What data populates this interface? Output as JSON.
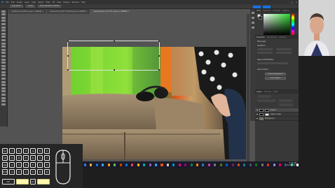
{
  "app": {
    "menu": [
      "Ps",
      "File",
      "Edit",
      "Image",
      "Layer",
      "Type",
      "Select",
      "Filter",
      "3D",
      "View",
      "Plugins",
      "Window",
      "Help"
    ],
    "window_controls": [
      "–",
      "□",
      "✕"
    ]
  },
  "options_bar": {
    "items": [
      "Auto-Select:",
      "Group",
      "Show Transform Controls"
    ]
  },
  "document_tabs": [
    {
      "label": "Untitled-1 @ 100% (Layer 0, RGB/8) ×",
      "active": false
    },
    {
      "label": "Screenshot @ 66.7% (Background, RGB/8) ×",
      "active": false
    },
    {
      "label": "pexels-photo @ 33.3% (Layer 1, RGB/8*) ×",
      "active": true
    }
  ],
  "panels": {
    "color": {
      "tabs": [
        "Color",
        "Swatches",
        "Gradients",
        "Patterns"
      ],
      "foreground": "#e8e8e8",
      "background": "#1b1b1b",
      "picker_hue": "#27d82a"
    },
    "properties": {
      "tabs": [
        "Properties",
        "Adjustments",
        "Libraries"
      ],
      "labels": [
        "Pixel Layer",
        "Transform",
        "Align and Distribute",
        "Quick Actions",
        "Remove Background",
        "Select Subject"
      ]
    },
    "layers": {
      "tabs": [
        "Layers",
        "Channels",
        "Paths"
      ],
      "rows": [
        {
          "label": "Layer 1",
          "selected": true
        },
        {
          "label": "Layer 0 copy",
          "selected": false
        },
        {
          "label": "Background",
          "selected": false
        }
      ]
    }
  },
  "taskbar": {
    "icons": [
      "#3a7bd5",
      "#e8b83a",
      "#1473e6",
      "#31a8ff",
      "#ff9a00",
      "#6cc24a",
      "#d83b01",
      "#0078d4",
      "#e74856",
      "#ffb900",
      "#00b294",
      "#8764b8",
      "#31a8ff",
      "#ff4f00",
      "#cccccc",
      "#0099bc",
      "#e3008c",
      "#9a0089",
      "#10893e",
      "#ff8c00",
      "#2d7d9a",
      "#c239b3",
      "#7a7574",
      "#498205",
      "#0063b1",
      "#68217a",
      "#ca5010",
      "#038387",
      "#4a5459",
      "#107c10",
      "#767676",
      "#da3b01",
      "#8e8cd8",
      "#ea005e",
      "#515c6b",
      "#00cc6a",
      "#ffffff"
    ],
    "time": "3:14 PM",
    "date": "5/19/2021"
  },
  "keyboard_overlay": {
    "row1": [
      "Esc",
      "1",
      "2",
      "3",
      "4",
      "5",
      "6"
    ],
    "row2": [
      "Tab",
      "Q",
      "W",
      "E",
      "R",
      "T",
      "Y"
    ],
    "row3": [
      "Caps",
      "A",
      "S",
      "D",
      "F",
      "G",
      "H"
    ],
    "row4": [
      "Shift",
      "Z",
      "X",
      "C",
      "V",
      "B",
      "N"
    ],
    "row5": [
      "Ctrl",
      "",
      "Alt",
      ""
    ]
  }
}
